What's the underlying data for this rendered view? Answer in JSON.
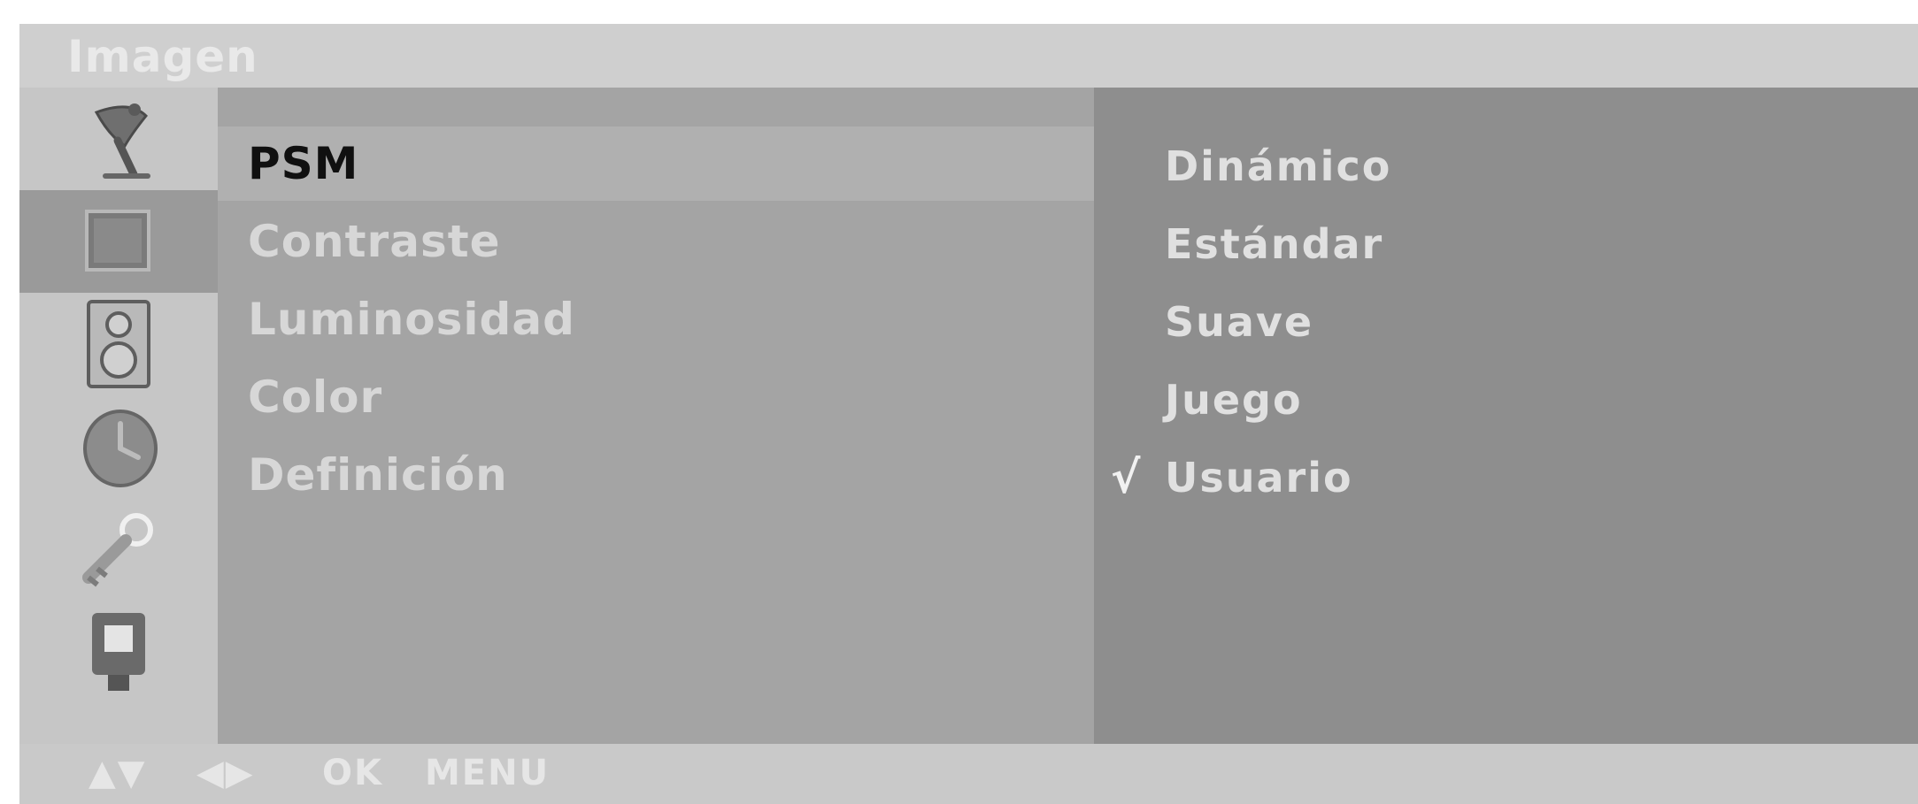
{
  "menu": {
    "title": "Imagen"
  },
  "icons": [
    {
      "name": "satellite-dish-icon",
      "selected": false
    },
    {
      "name": "picture-icon",
      "selected": true
    },
    {
      "name": "speaker-icon",
      "selected": false
    },
    {
      "name": "clock-icon",
      "selected": false
    },
    {
      "name": "key-icon",
      "selected": false
    },
    {
      "name": "input-plug-icon",
      "selected": false
    }
  ],
  "items": [
    {
      "label": "PSM",
      "active": true
    },
    {
      "label": "Contraste",
      "active": false
    },
    {
      "label": "Luminosidad",
      "active": false
    },
    {
      "label": "Color",
      "active": false
    },
    {
      "label": "Definición",
      "active": false
    }
  ],
  "options": [
    {
      "label": "Dinámico",
      "check": ""
    },
    {
      "label": "Estándar",
      "check": ""
    },
    {
      "label": "Suave",
      "check": ""
    },
    {
      "label": "Juego",
      "check": ""
    },
    {
      "label": "Usuario",
      "check": "√"
    }
  ],
  "footer": {
    "updown": "▲▼",
    "leftright": "◀▶",
    "ok": "OK",
    "menu": "MENU"
  },
  "colors": {
    "title_bar": "#cfcfcf",
    "items_panel": "#a4a4a4",
    "options_panel": "#8e8e8e",
    "active_item_text": "#101010"
  }
}
